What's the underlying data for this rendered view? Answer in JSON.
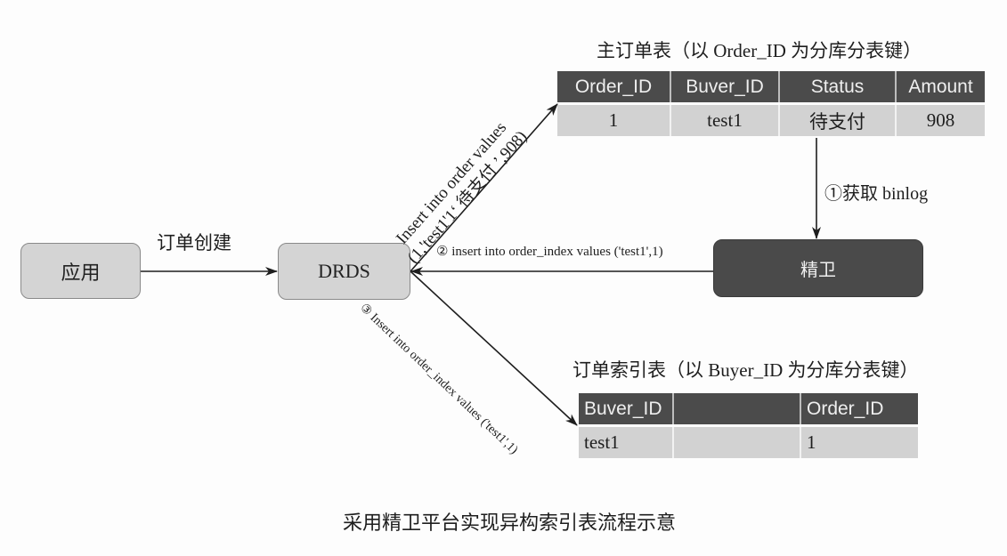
{
  "nodes": {
    "app": {
      "label": "应用"
    },
    "drds": {
      "label": "DRDS"
    },
    "jingwei": {
      "label": "精卫"
    }
  },
  "edges": {
    "order_create": {
      "label": "订单创建"
    },
    "insert_order": {
      "line1": "Insert into order values",
      "line2": "(1,'test1'1‘ 待支付 ’,908)"
    },
    "get_binlog": {
      "label": "①获取 binlog"
    },
    "insert_index_2": {
      "label": "② insert into order_index values ('test1',1)"
    },
    "insert_index_3": {
      "label": "③ Insert into order_index values ('test1',1)"
    }
  },
  "main_table": {
    "title": "主订单表（以 Order_ID 为分库分表键）",
    "headers": [
      "Order_ID",
      "Buver_ID",
      "Status",
      "Amount"
    ],
    "rows": [
      [
        "1",
        "test1",
        "待支付",
        "908"
      ]
    ]
  },
  "index_table": {
    "title": "订单索引表（以 Buyer_ID 为分库分表键）",
    "headers": [
      "Buver_ID",
      "",
      "Order_ID"
    ],
    "rows": [
      [
        "test1",
        "",
        "1"
      ]
    ]
  },
  "caption": "采用精卫平台实现异构索引表流程示意"
}
